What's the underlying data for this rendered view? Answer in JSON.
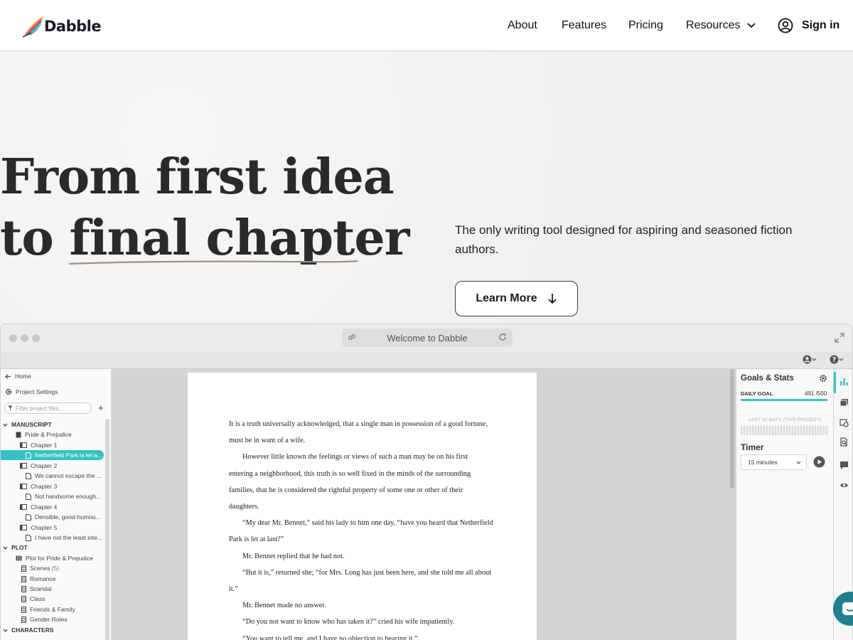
{
  "brand": {
    "name": "Dabble"
  },
  "nav": {
    "about": "About",
    "features": "Features",
    "pricing": "Pricing",
    "resources": "Resources",
    "sign_in": "Sign in"
  },
  "hero": {
    "title_line1": "From first idea",
    "title_line2_prefix": "to ",
    "title_line2_emph": "final chapter",
    "subtitle": "The only writing tool designed for aspiring and seasoned fiction authors.",
    "cta": "Learn More"
  },
  "app": {
    "address_bar": "Welcome to Dabble",
    "sidebar": {
      "home": "Home",
      "project_settings": "Project Settings",
      "filter_placeholder": "Filter project files...",
      "manuscript": "MANUSCRIPT",
      "book": "Pride & Prejudice",
      "items": [
        {
          "kind": "chapter",
          "label": "Chapter 1"
        },
        {
          "kind": "scene",
          "label": "Netherfield Park is let a...",
          "selected": true
        },
        {
          "kind": "chapter",
          "label": "Chapter 2"
        },
        {
          "kind": "scene",
          "label": "We cannot escape the ..."
        },
        {
          "kind": "chapter",
          "label": "Chapter 3"
        },
        {
          "kind": "scene",
          "label": "Not handsome enough..."
        },
        {
          "kind": "chapter",
          "label": "Chapter 4"
        },
        {
          "kind": "scene",
          "label": "Densible, good-humou..."
        },
        {
          "kind": "chapter",
          "label": "Chapter 5"
        },
        {
          "kind": "scene",
          "label": "I have not the least inte..."
        }
      ],
      "plot": "PLOT",
      "plot_book": "Plot for Pride & Prejudice",
      "plot_items": [
        {
          "label": "Scenes",
          "count": "(5)"
        },
        {
          "label": "Romance"
        },
        {
          "label": "Scandal"
        },
        {
          "label": "Class"
        },
        {
          "label": "Friends & Family"
        },
        {
          "label": "Gender Roles"
        }
      ],
      "characters": "CHARACTERS"
    },
    "document": {
      "paragraphs": [
        "It is a truth universally acknowledged, that a single man in possession of a good fortune, must be in want of a wife.",
        "However little known the feelings or views of such a man may be on his first entering a neighborhood, this truth is so well fixed in the minds of the surrounding families, that he is considered the rightful property of some one or other of their daughters.",
        "“My dear Mr. Bennet,” said his lady to him one day, “have you heard that Netherfield Park is let at last?”",
        "Mr. Bennet replied that he had not.",
        "“But it is,” returned she; “for Mrs. Long has just been here, and she told me all about it.”",
        "Mr. Bennet made no answer.",
        "“Do you not want to know who has taken it?” cried his wife impatiently.",
        "“You want to tell me, and I have no objection to hearing it.”"
      ]
    },
    "goals": {
      "title": "Goals & Stats",
      "daily_goal_label": "DAILY GOAL",
      "daily_goal_current": "491",
      "daily_goal_target": "500",
      "daily_goal_display": "491 /500",
      "daily_goal_progress": 0.982,
      "last30_label": "LAST 30 DAYS (THIS PROJECT)",
      "timer_label": "Timer",
      "timer_value": "15 minutes"
    }
  },
  "colors": {
    "accent": "#35c2c6",
    "hero_bg": "#f2f1ef",
    "title_text": "#2a2a2a",
    "underline": "#9a8f8a",
    "chat_bubble": "#1f7f8f"
  }
}
